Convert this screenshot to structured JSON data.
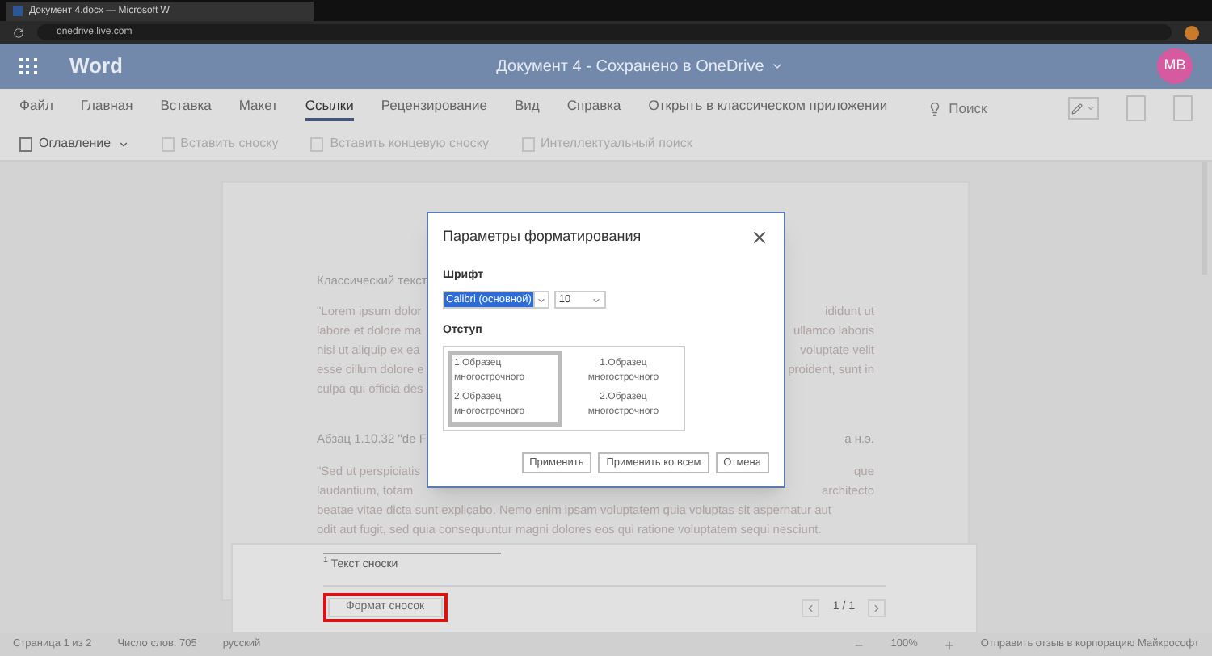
{
  "browser": {
    "tab_title": "Документ 4.docx — Microsoft W",
    "url": "onedrive.live.com"
  },
  "app": {
    "name": "Word",
    "doc_title": "Документ 4  -  Сохранено в OneDrive",
    "avatar": "MB"
  },
  "ribbon_tabs": [
    {
      "label": "Файл",
      "selected": false
    },
    {
      "label": "Главная",
      "selected": false
    },
    {
      "label": "Вставка",
      "selected": false
    },
    {
      "label": "Макет",
      "selected": false
    },
    {
      "label": "Ссылки",
      "selected": true
    },
    {
      "label": "Рецензирование",
      "selected": false
    },
    {
      "label": "Вид",
      "selected": false
    },
    {
      "label": "Справка",
      "selected": false
    },
    {
      "label": "Открыть в классическом приложении",
      "selected": false
    }
  ],
  "search": {
    "placeholder": "Поиск"
  },
  "toolbar": [
    {
      "label": "Оглавление",
      "disabled": false
    },
    {
      "label": "Вставить сноску",
      "disabled": true
    },
    {
      "label": "Вставить концевую сноску",
      "disabled": true
    },
    {
      "label": "Интеллектуальный поиск",
      "disabled": true
    }
  ],
  "document": {
    "lines": [
      {
        "left": "Классический текст",
        "kind": "heading"
      },
      {
        "left": "\"Lorem ipsum dolor",
        "right": "ididunt ut",
        "kind": "body"
      },
      {
        "left": "labore et dolore ma",
        "right": "ullamco laboris",
        "kind": "body"
      },
      {
        "left": "nisi ut aliquip ex ea",
        "right": "voluptate velit",
        "kind": "body"
      },
      {
        "left": "esse cillum dolore e",
        "right": "proident, sunt in",
        "kind": "body"
      },
      {
        "left": "culpa qui officia des",
        "kind": "body"
      },
      {
        "left": "Абзац 1.10.32 \"de F",
        "right": "а н.э.",
        "kind": "heading"
      },
      {
        "left": "\"Sed ut perspiciatis",
        "right": "que",
        "kind": "body"
      },
      {
        "left": "laudantium, totam",
        "right": "architecto",
        "kind": "body"
      },
      {
        "left": "beatae vitae dicta sunt explicabo. Nemo enim ipsam voluptatem quia voluptas sit aspernatur aut",
        "kind": "body"
      },
      {
        "left": "odit aut fugit, sed quia consequuntur magni dolores eos qui ratione voluptatem sequi nesciunt.",
        "kind": "body"
      }
    ]
  },
  "footnote_pane": {
    "text": "$^{1}$ Текст сноски",
    "format_button": "Формат сносок",
    "pager": "1 / 1"
  },
  "dialog": {
    "title": "Параметры форматирования",
    "font_label": "Шрифт",
    "font": "Calibri (основной)",
    "size": "10",
    "indent_label": "Отступ",
    "indent_options": [
      {
        "lines": [
          "1.Образец многострочного",
          "2.Образец многострочного"
        ],
        "selected": true
      },
      {
        "lines": [
          "1.Образец многострочного",
          "2.Образец многострочного"
        ],
        "selected": false
      }
    ],
    "buttons": [
      "Применить",
      "Применить ко всем",
      "Отмена"
    ]
  },
  "status_bar": {
    "page": "Страница 1 из 2",
    "words": "Число слов: 705",
    "language": "русский",
    "zoom": "100%",
    "feedback": "Отправить отзыв в корпорацию Майкрософт"
  }
}
